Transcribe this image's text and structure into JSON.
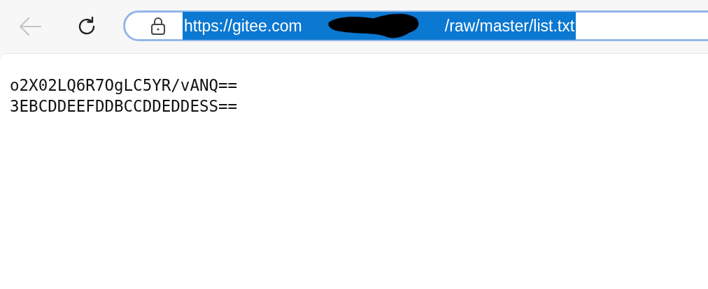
{
  "toolbar": {
    "back_disabled": true,
    "address": {
      "url_start": "https://gitee.com",
      "url_end": "/raw/master/list.txt",
      "selected": true,
      "redacted": true
    }
  },
  "page": {
    "lines": [
      "o2X02LQ6R7OgLC5YR/vANQ==",
      "3EBCDDEEFDDBCCDDEDDESS=="
    ]
  }
}
